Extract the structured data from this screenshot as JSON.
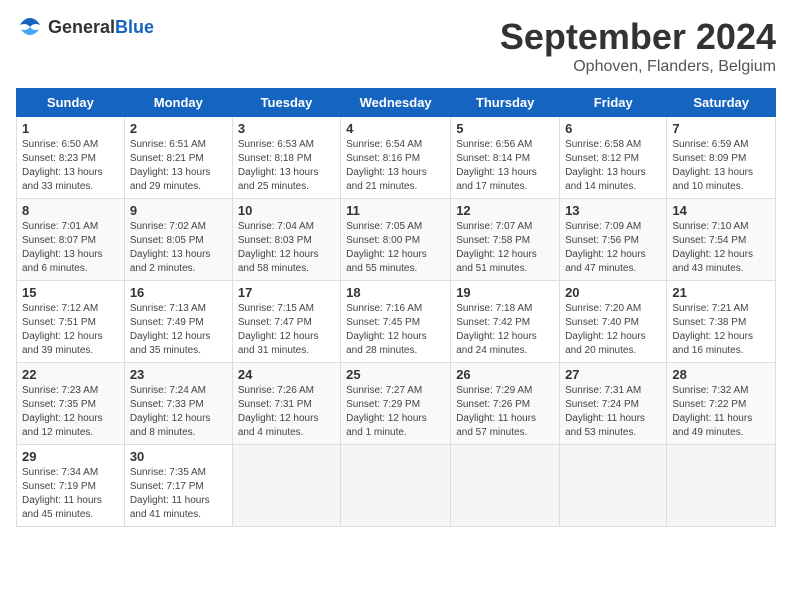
{
  "header": {
    "logo_general": "General",
    "logo_blue": "Blue",
    "month_title": "September 2024",
    "location": "Ophoven, Flanders, Belgium"
  },
  "weekdays": [
    "Sunday",
    "Monday",
    "Tuesday",
    "Wednesday",
    "Thursday",
    "Friday",
    "Saturday"
  ],
  "weeks": [
    [
      {
        "day": "1",
        "sunrise": "Sunrise: 6:50 AM",
        "sunset": "Sunset: 8:23 PM",
        "daylight": "Daylight: 13 hours and 33 minutes."
      },
      {
        "day": "2",
        "sunrise": "Sunrise: 6:51 AM",
        "sunset": "Sunset: 8:21 PM",
        "daylight": "Daylight: 13 hours and 29 minutes."
      },
      {
        "day": "3",
        "sunrise": "Sunrise: 6:53 AM",
        "sunset": "Sunset: 8:18 PM",
        "daylight": "Daylight: 13 hours and 25 minutes."
      },
      {
        "day": "4",
        "sunrise": "Sunrise: 6:54 AM",
        "sunset": "Sunset: 8:16 PM",
        "daylight": "Daylight: 13 hours and 21 minutes."
      },
      {
        "day": "5",
        "sunrise": "Sunrise: 6:56 AM",
        "sunset": "Sunset: 8:14 PM",
        "daylight": "Daylight: 13 hours and 17 minutes."
      },
      {
        "day": "6",
        "sunrise": "Sunrise: 6:58 AM",
        "sunset": "Sunset: 8:12 PM",
        "daylight": "Daylight: 13 hours and 14 minutes."
      },
      {
        "day": "7",
        "sunrise": "Sunrise: 6:59 AM",
        "sunset": "Sunset: 8:09 PM",
        "daylight": "Daylight: 13 hours and 10 minutes."
      }
    ],
    [
      {
        "day": "8",
        "sunrise": "Sunrise: 7:01 AM",
        "sunset": "Sunset: 8:07 PM",
        "daylight": "Daylight: 13 hours and 6 minutes."
      },
      {
        "day": "9",
        "sunrise": "Sunrise: 7:02 AM",
        "sunset": "Sunset: 8:05 PM",
        "daylight": "Daylight: 13 hours and 2 minutes."
      },
      {
        "day": "10",
        "sunrise": "Sunrise: 7:04 AM",
        "sunset": "Sunset: 8:03 PM",
        "daylight": "Daylight: 12 hours and 58 minutes."
      },
      {
        "day": "11",
        "sunrise": "Sunrise: 7:05 AM",
        "sunset": "Sunset: 8:00 PM",
        "daylight": "Daylight: 12 hours and 55 minutes."
      },
      {
        "day": "12",
        "sunrise": "Sunrise: 7:07 AM",
        "sunset": "Sunset: 7:58 PM",
        "daylight": "Daylight: 12 hours and 51 minutes."
      },
      {
        "day": "13",
        "sunrise": "Sunrise: 7:09 AM",
        "sunset": "Sunset: 7:56 PM",
        "daylight": "Daylight: 12 hours and 47 minutes."
      },
      {
        "day": "14",
        "sunrise": "Sunrise: 7:10 AM",
        "sunset": "Sunset: 7:54 PM",
        "daylight": "Daylight: 12 hours and 43 minutes."
      }
    ],
    [
      {
        "day": "15",
        "sunrise": "Sunrise: 7:12 AM",
        "sunset": "Sunset: 7:51 PM",
        "daylight": "Daylight: 12 hours and 39 minutes."
      },
      {
        "day": "16",
        "sunrise": "Sunrise: 7:13 AM",
        "sunset": "Sunset: 7:49 PM",
        "daylight": "Daylight: 12 hours and 35 minutes."
      },
      {
        "day": "17",
        "sunrise": "Sunrise: 7:15 AM",
        "sunset": "Sunset: 7:47 PM",
        "daylight": "Daylight: 12 hours and 31 minutes."
      },
      {
        "day": "18",
        "sunrise": "Sunrise: 7:16 AM",
        "sunset": "Sunset: 7:45 PM",
        "daylight": "Daylight: 12 hours and 28 minutes."
      },
      {
        "day": "19",
        "sunrise": "Sunrise: 7:18 AM",
        "sunset": "Sunset: 7:42 PM",
        "daylight": "Daylight: 12 hours and 24 minutes."
      },
      {
        "day": "20",
        "sunrise": "Sunrise: 7:20 AM",
        "sunset": "Sunset: 7:40 PM",
        "daylight": "Daylight: 12 hours and 20 minutes."
      },
      {
        "day": "21",
        "sunrise": "Sunrise: 7:21 AM",
        "sunset": "Sunset: 7:38 PM",
        "daylight": "Daylight: 12 hours and 16 minutes."
      }
    ],
    [
      {
        "day": "22",
        "sunrise": "Sunrise: 7:23 AM",
        "sunset": "Sunset: 7:35 PM",
        "daylight": "Daylight: 12 hours and 12 minutes."
      },
      {
        "day": "23",
        "sunrise": "Sunrise: 7:24 AM",
        "sunset": "Sunset: 7:33 PM",
        "daylight": "Daylight: 12 hours and 8 minutes."
      },
      {
        "day": "24",
        "sunrise": "Sunrise: 7:26 AM",
        "sunset": "Sunset: 7:31 PM",
        "daylight": "Daylight: 12 hours and 4 minutes."
      },
      {
        "day": "25",
        "sunrise": "Sunrise: 7:27 AM",
        "sunset": "Sunset: 7:29 PM",
        "daylight": "Daylight: 12 hours and 1 minute."
      },
      {
        "day": "26",
        "sunrise": "Sunrise: 7:29 AM",
        "sunset": "Sunset: 7:26 PM",
        "daylight": "Daylight: 11 hours and 57 minutes."
      },
      {
        "day": "27",
        "sunrise": "Sunrise: 7:31 AM",
        "sunset": "Sunset: 7:24 PM",
        "daylight": "Daylight: 11 hours and 53 minutes."
      },
      {
        "day": "28",
        "sunrise": "Sunrise: 7:32 AM",
        "sunset": "Sunset: 7:22 PM",
        "daylight": "Daylight: 11 hours and 49 minutes."
      }
    ],
    [
      {
        "day": "29",
        "sunrise": "Sunrise: 7:34 AM",
        "sunset": "Sunset: 7:19 PM",
        "daylight": "Daylight: 11 hours and 45 minutes."
      },
      {
        "day": "30",
        "sunrise": "Sunrise: 7:35 AM",
        "sunset": "Sunset: 7:17 PM",
        "daylight": "Daylight: 11 hours and 41 minutes."
      },
      null,
      null,
      null,
      null,
      null
    ]
  ]
}
